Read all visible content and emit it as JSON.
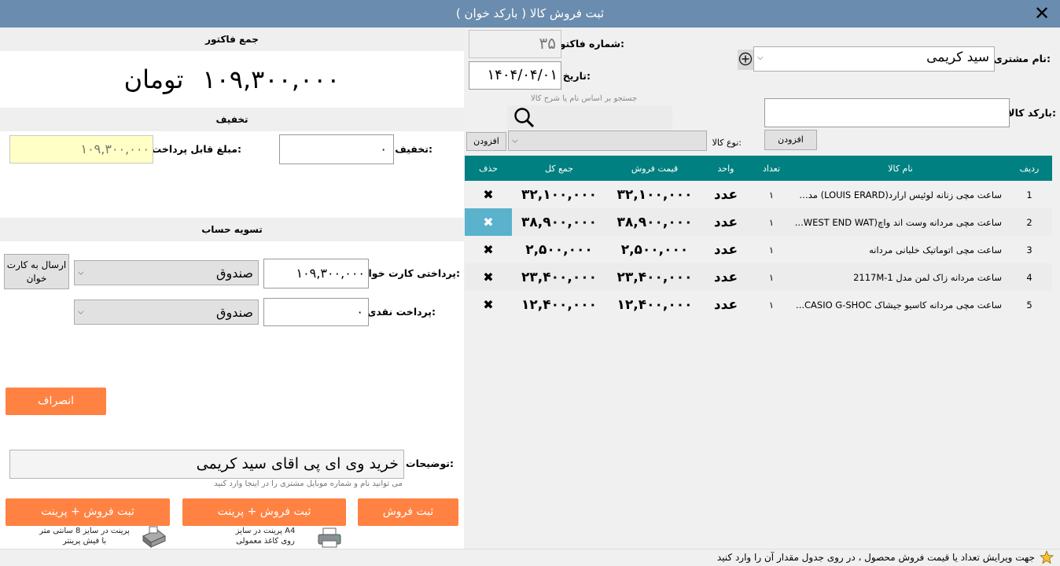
{
  "window": {
    "title": "ثبت فروش کالا ( بارکد خوان )"
  },
  "invoice_total": {
    "header": "جمع فاکتور",
    "amount": "۱۰۹,۳۰۰,۰۰۰",
    "currency": "تومان"
  },
  "discount": {
    "header": "تخفیف",
    "discount_label": "تخفیف:",
    "discount_value": "۰",
    "payable_label": "مبلغ قابل پرداخت:",
    "payable_value": "۱۰۹,۳۰۰,۰۰۰"
  },
  "settlement": {
    "header": "تسویه حساب",
    "card_label": "پرداختی کارت خوان:",
    "card_value": "۱۰۹,۳۰۰,۰۰۰",
    "card_account": "صندوق",
    "send_card_button": "ارسال به کارت خوان",
    "cash_label": "پرداخت نقدی:",
    "cash_value": "۰",
    "cash_account": "صندوق",
    "cancel_button": "انصراف"
  },
  "notes": {
    "label": "توضیحات:",
    "value": "خرید وی ای پی اقای سید کریمی",
    "hint": "می توانید نام و شماره موبایل مشتری را در اینجا وارد کنید"
  },
  "actions": {
    "save": "ثبت فروش",
    "save_print_a4": "ثبت فروش + پرینت",
    "save_print_receipt": "ثبت فروش + پرینت",
    "a4_caption_1": "پرینت در سایز A4",
    "a4_caption_2": "روی کاغذ معمولی",
    "receipt_caption_1": "پرینت در سایز 8 سانتی متر",
    "receipt_caption_2": "با فیش پرینتر"
  },
  "header_form": {
    "invoice_number_label": "شماره فاکتور:",
    "invoice_number": "۳۵",
    "date_label": "تاریخ:",
    "date": "۱۴۰۴/۰۴/۰۱",
    "customer_label": "نام مشتری:",
    "customer": "سید کریمی",
    "barcode_label": "بارکد کالا:",
    "barcode_value": "",
    "add_barcode_button": "افزودن",
    "search_hint": "جستجو بر اساس نام یا شرح کالا",
    "product_type_label": "نوع کالا:",
    "product_type_value": "",
    "add_type_button": "افزودن"
  },
  "table": {
    "headers": [
      "ردیف",
      "نام کالا",
      "تعداد",
      "واحد",
      "قیمت فروش",
      "جمع کل",
      "حذف"
    ],
    "rows": [
      {
        "row": "1",
        "name": "ساعت مچی زنانه لوئیس ارارد(LOUIS ERARD) مدل ...",
        "qty": "۱",
        "unit": "عدد",
        "price": "۳۲,۱۰۰,۰۰۰",
        "total": "۳۲,۱۰۰,۰۰۰"
      },
      {
        "row": "2",
        "name": "ساعت مچی مردانه وست اند واچ(WEST END WAT...",
        "qty": "۱",
        "unit": "عدد",
        "price": "۳۸,۹۰۰,۰۰۰",
        "total": "۳۸,۹۰۰,۰۰۰"
      },
      {
        "row": "3",
        "name": "ساعت مچی اتوماتیک خلبانی مردانه",
        "qty": "۱",
        "unit": "عدد",
        "price": "۲,۵۰۰,۰۰۰",
        "total": "۲,۵۰۰,۰۰۰"
      },
      {
        "row": "4",
        "name": "ساعت مردانه زاک لمن مدل 2117M-1",
        "qty": "۱",
        "unit": "عدد",
        "price": "۲۳,۴۰۰,۰۰۰",
        "total": "۲۳,۴۰۰,۰۰۰"
      },
      {
        "row": "5",
        "name": "ساعت مچی مردانه کاسیو جیشاک CASIO G-SHOC...",
        "qty": "۱",
        "unit": "عدد",
        "price": "۱۲,۴۰۰,۰۰۰",
        "total": "۱۲,۴۰۰,۰۰۰"
      }
    ],
    "delete_symbol": "✖"
  },
  "status": {
    "text": "جهت ویرایش تعداد یا قیمت فروش محصول ، در روی جدول مقدار آن را وارد کنید"
  },
  "colors": {
    "titlebar": "#6a8cae",
    "table_header": "#008080",
    "orange": "#ff8242",
    "selected": "#5ab2cc",
    "payable_bg": "#ffffc6"
  }
}
